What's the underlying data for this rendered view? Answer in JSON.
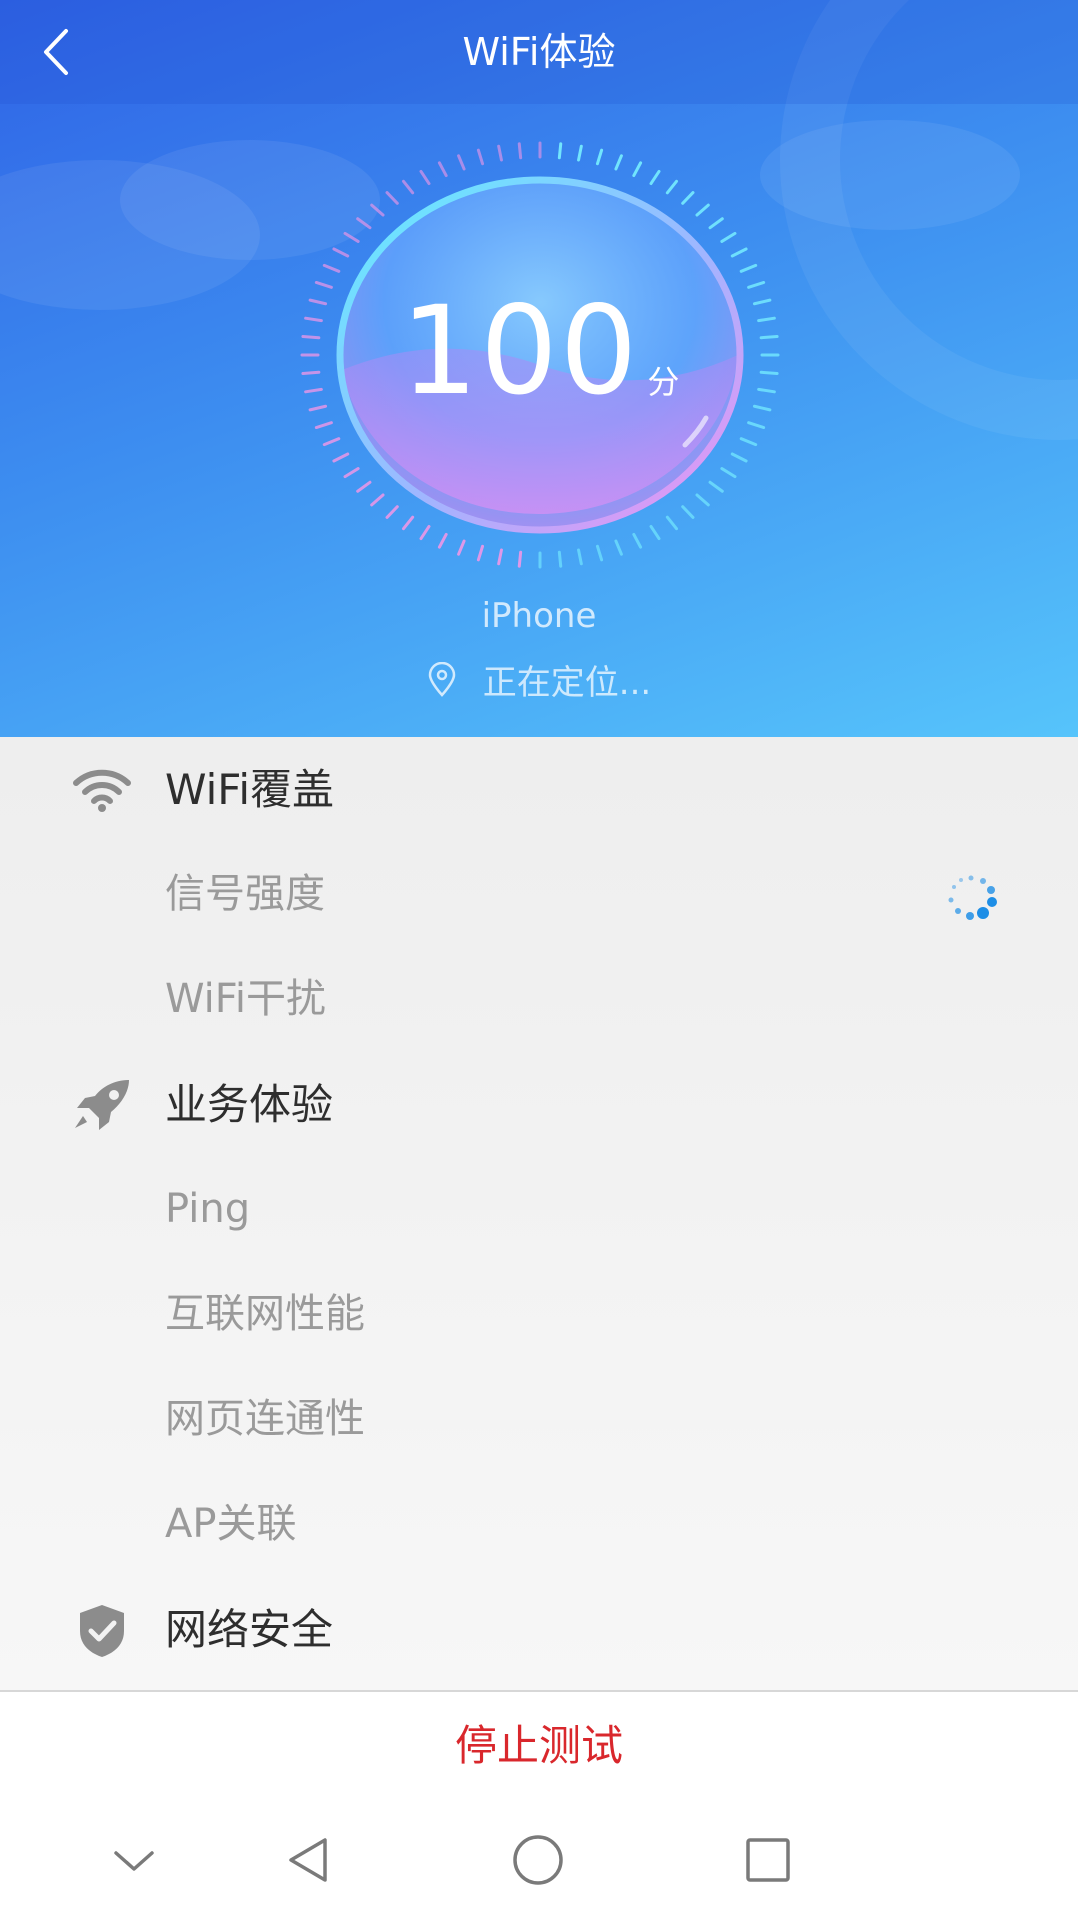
{
  "header": {
    "title": "WiFi体验",
    "score": "100",
    "score_unit": "分",
    "device_name": "iPhone",
    "location_status": "正在定位..."
  },
  "sections": [
    {
      "label": "WiFi覆盖",
      "icon": "wifi-icon",
      "items": [
        {
          "label": "信号强度",
          "status": "loading"
        },
        {
          "label": "WiFi干扰"
        }
      ]
    },
    {
      "label": "业务体验",
      "icon": "rocket-icon",
      "items": [
        {
          "label": "Ping"
        },
        {
          "label": "互联网性能"
        },
        {
          "label": "网页连通性"
        },
        {
          "label": "AP关联"
        }
      ]
    },
    {
      "label": "网络安全",
      "icon": "shield-check-icon",
      "items": []
    }
  ],
  "actions": {
    "stop_label": "停止测试"
  },
  "nav": [
    "chevron-down-icon",
    "nav-back-icon",
    "nav-home-icon",
    "nav-recents-icon"
  ],
  "colors": {
    "header_gradient_start": "#2f63e6",
    "header_gradient_end": "#56c4fb",
    "stop_text": "#d9272c",
    "spinner": "#1e8ee6",
    "section_icon": "#8c8c8c"
  }
}
